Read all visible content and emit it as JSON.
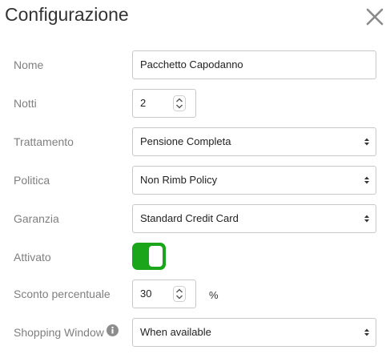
{
  "dialog": {
    "title": "Configurazione",
    "close_icon": "close-icon"
  },
  "fields": {
    "nome": {
      "label": "Nome",
      "value": "Pacchetto Capodanno"
    },
    "notti": {
      "label": "Notti",
      "value": "2"
    },
    "trattamento": {
      "label": "Trattamento",
      "value": "Pensione Completa"
    },
    "politica": {
      "label": "Politica",
      "value": "Non Rimb Policy"
    },
    "garanzia": {
      "label": "Garanzia",
      "value": "Standard Credit Card"
    },
    "attivato": {
      "label": "Attivato",
      "state": "on"
    },
    "sconto": {
      "label": "Sconto percentuale",
      "value": "30",
      "unit": "%"
    },
    "shopping_window": {
      "label": "Shopping Window",
      "value": "When available",
      "info_icon": "info-icon"
    }
  },
  "colors": {
    "toggle_on": "#1aa51a",
    "label_gray": "#7f7f7f",
    "border": "#c8c8c8"
  }
}
